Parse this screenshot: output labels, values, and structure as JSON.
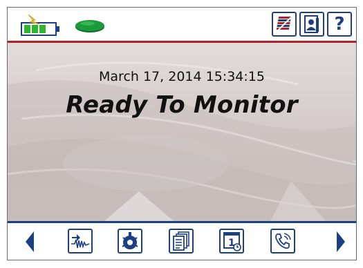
{
  "status_bar": {
    "battery_icon": "battery-charging-icon",
    "status_indicator_icon": "green-oval-indicator-icon",
    "buttons": [
      {
        "name": "settings-button",
        "icon": "striped-flag-icon"
      },
      {
        "name": "user-button",
        "icon": "user-card-icon"
      },
      {
        "name": "help-button",
        "icon": "question-mark-icon",
        "glyph": "?"
      }
    ]
  },
  "main": {
    "datetime": "March 17, 2014 15:34:15",
    "status_text": "Ready To Monitor"
  },
  "bottom_nav": {
    "prev_icon": "left-arrow-icon",
    "next_icon": "right-arrow-icon",
    "buttons": [
      {
        "name": "waveform-button",
        "icon": "waveform-icon"
      },
      {
        "name": "sensor-button",
        "icon": "geophone-sensor-icon"
      },
      {
        "name": "documents-button",
        "icon": "documents-stack-icon"
      },
      {
        "name": "schedule-button",
        "icon": "calendar-clock-icon",
        "glyph": "1"
      },
      {
        "name": "call-button",
        "icon": "phone-call-icon"
      }
    ]
  },
  "colors": {
    "accent_blue": "#1c3f82",
    "accent_red": "#b32026",
    "battery_green": "#2fb52f",
    "indicator_green": "#1a9a3a"
  }
}
